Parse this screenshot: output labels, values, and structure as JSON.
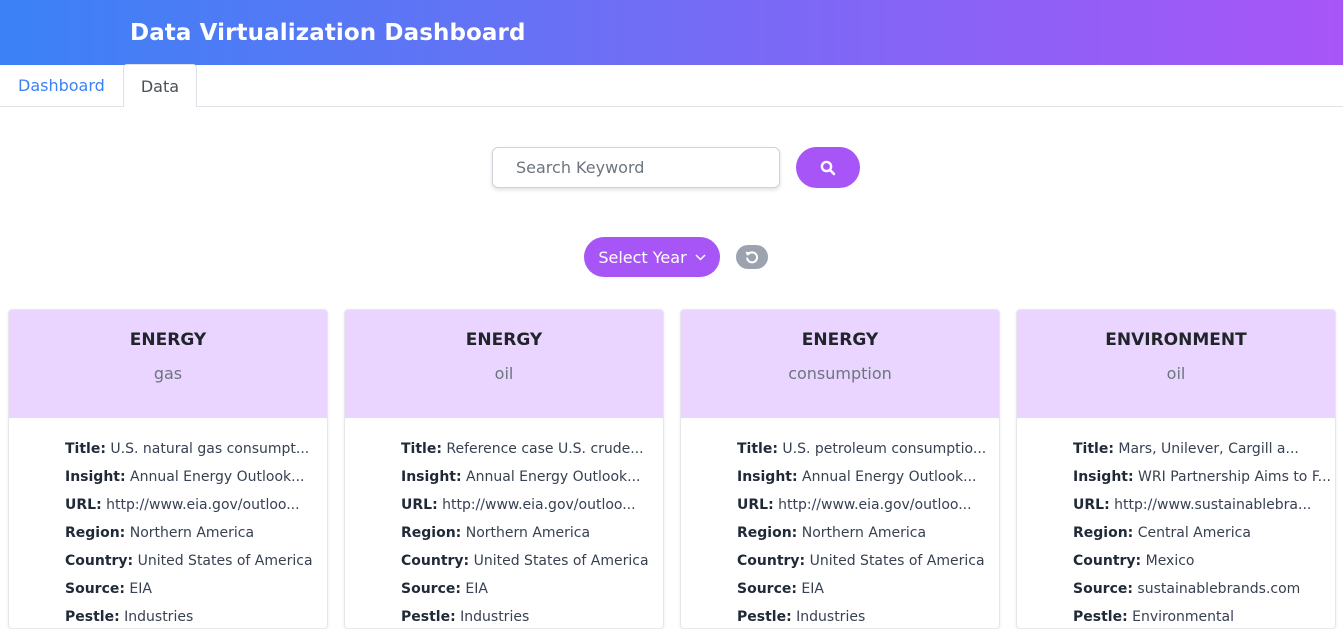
{
  "header": {
    "title": "Data Virtualization Dashboard"
  },
  "tabs": [
    {
      "label": "Dashboard"
    },
    {
      "label": "Data"
    }
  ],
  "search": {
    "placeholder": "Search Keyword",
    "value": ""
  },
  "filters": {
    "year_label": "Select Year"
  },
  "icons": {
    "search": "search-icon",
    "chevron": "chevron-down-icon",
    "reset": "reset-icon"
  },
  "colors": {
    "accent": "#a855f7",
    "header_start": "#3b82f6",
    "header_end": "#a855f7",
    "card_header": "#e9d5ff"
  },
  "field_labels": {
    "title": "Title:",
    "insight": "Insight:",
    "url": "URL:",
    "region": "Region:",
    "country": "Country:",
    "source": "Source:",
    "pestle": "Pestle:"
  },
  "cards": [
    {
      "sector": "ENERGY",
      "topic": "gas",
      "title": "U.S. natural gas consumpt...",
      "insight": "Annual Energy Outlook...",
      "url": "http://www.eia.gov/outloo...",
      "region": "Northern America",
      "country": "United States of America",
      "source": "EIA",
      "pestle": "Industries"
    },
    {
      "sector": "ENERGY",
      "topic": "oil",
      "title": "Reference case U.S. crude...",
      "insight": "Annual Energy Outlook...",
      "url": "http://www.eia.gov/outloo...",
      "region": "Northern America",
      "country": "United States of America",
      "source": "EIA",
      "pestle": "Industries"
    },
    {
      "sector": "ENERGY",
      "topic": "consumption",
      "title": "U.S. petroleum consumptio...",
      "insight": "Annual Energy Outlook...",
      "url": "http://www.eia.gov/outloo...",
      "region": "Northern America",
      "country": "United States of America",
      "source": "EIA",
      "pestle": "Industries"
    },
    {
      "sector": "ENVIRONMENT",
      "topic": "oil",
      "title": "Mars, Unilever, Cargill a...",
      "insight": "WRI Partnership Aims to F...",
      "url": "http://www.sustainablebra...",
      "region": "Central America",
      "country": "Mexico",
      "source": "sustainablebrands.com",
      "pestle": "Environmental"
    }
  ]
}
